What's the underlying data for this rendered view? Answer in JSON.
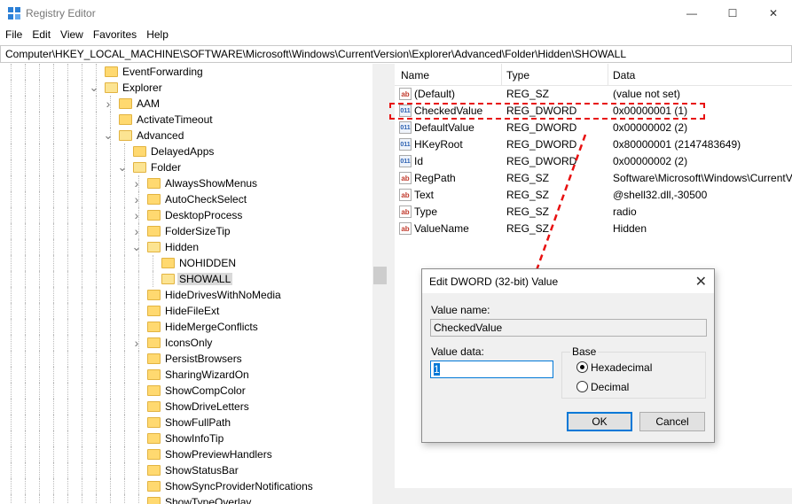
{
  "window": {
    "title": "Registry Editor",
    "minimize": "—",
    "maximize": "☐",
    "close": "✕"
  },
  "menu": [
    "File",
    "Edit",
    "View",
    "Favorites",
    "Help"
  ],
  "address": "Computer\\HKEY_LOCAL_MACHINE\\SOFTWARE\\Microsoft\\Windows\\CurrentVersion\\Explorer\\Advanced\\Folder\\Hidden\\SHOWALL",
  "tree": [
    {
      "label": "EventForwarding",
      "depth": 0,
      "expander": "",
      "selected": false
    },
    {
      "label": "Explorer",
      "depth": 0,
      "expander": "v",
      "selected": false
    },
    {
      "label": "AAM",
      "depth": 1,
      "expander": ">",
      "selected": false
    },
    {
      "label": "ActivateTimeout",
      "depth": 1,
      "expander": "",
      "selected": false
    },
    {
      "label": "Advanced",
      "depth": 1,
      "expander": "v",
      "selected": false
    },
    {
      "label": "DelayedApps",
      "depth": 2,
      "expander": "",
      "selected": false
    },
    {
      "label": "Folder",
      "depth": 2,
      "expander": "v",
      "selected": false
    },
    {
      "label": "AlwaysShowMenus",
      "depth": 3,
      "expander": ">",
      "selected": false
    },
    {
      "label": "AutoCheckSelect",
      "depth": 3,
      "expander": ">",
      "selected": false
    },
    {
      "label": "DesktopProcess",
      "depth": 3,
      "expander": ">",
      "selected": false
    },
    {
      "label": "FolderSizeTip",
      "depth": 3,
      "expander": ">",
      "selected": false
    },
    {
      "label": "Hidden",
      "depth": 3,
      "expander": "v",
      "selected": false
    },
    {
      "label": "NOHIDDEN",
      "depth": 4,
      "expander": "",
      "selected": false
    },
    {
      "label": "SHOWALL",
      "depth": 4,
      "expander": "",
      "selected": true
    },
    {
      "label": "HideDrivesWithNoMedia",
      "depth": 3,
      "expander": "",
      "selected": false
    },
    {
      "label": "HideFileExt",
      "depth": 3,
      "expander": "",
      "selected": false
    },
    {
      "label": "HideMergeConflicts",
      "depth": 3,
      "expander": "",
      "selected": false
    },
    {
      "label": "IconsOnly",
      "depth": 3,
      "expander": ">",
      "selected": false
    },
    {
      "label": "PersistBrowsers",
      "depth": 3,
      "expander": "",
      "selected": false
    },
    {
      "label": "SharingWizardOn",
      "depth": 3,
      "expander": "",
      "selected": false
    },
    {
      "label": "ShowCompColor",
      "depth": 3,
      "expander": "",
      "selected": false
    },
    {
      "label": "ShowDriveLetters",
      "depth": 3,
      "expander": "",
      "selected": false
    },
    {
      "label": "ShowFullPath",
      "depth": 3,
      "expander": "",
      "selected": false
    },
    {
      "label": "ShowInfoTip",
      "depth": 3,
      "expander": "",
      "selected": false
    },
    {
      "label": "ShowPreviewHandlers",
      "depth": 3,
      "expander": "",
      "selected": false
    },
    {
      "label": "ShowStatusBar",
      "depth": 3,
      "expander": "",
      "selected": false
    },
    {
      "label": "ShowSyncProviderNotifications",
      "depth": 3,
      "expander": "",
      "selected": false
    },
    {
      "label": "ShowTypeOverlay",
      "depth": 3,
      "expander": "",
      "selected": false
    }
  ],
  "list": {
    "columns": [
      "Name",
      "Type",
      "Data"
    ],
    "rows": [
      {
        "icon": "ab",
        "name": "(Default)",
        "type": "REG_SZ",
        "data": "(value not set)"
      },
      {
        "icon": "bin",
        "name": "CheckedValue",
        "type": "REG_DWORD",
        "data": "0x00000001 (1)"
      },
      {
        "icon": "bin",
        "name": "DefaultValue",
        "type": "REG_DWORD",
        "data": "0x00000002 (2)"
      },
      {
        "icon": "bin",
        "name": "HKeyRoot",
        "type": "REG_DWORD",
        "data": "0x80000001 (2147483649)"
      },
      {
        "icon": "bin",
        "name": "Id",
        "type": "REG_DWORD",
        "data": "0x00000002 (2)"
      },
      {
        "icon": "ab",
        "name": "RegPath",
        "type": "REG_SZ",
        "data": "Software\\Microsoft\\Windows\\CurrentV"
      },
      {
        "icon": "ab",
        "name": "Text",
        "type": "REG_SZ",
        "data": "@shell32.dll,-30500"
      },
      {
        "icon": "ab",
        "name": "Type",
        "type": "REG_SZ",
        "data": "radio"
      },
      {
        "icon": "ab",
        "name": "ValueName",
        "type": "REG_SZ",
        "data": "Hidden"
      }
    ]
  },
  "dialog": {
    "title": "Edit DWORD (32-bit) Value",
    "close": "✕",
    "value_name_label": "Value name:",
    "value_name": "CheckedValue",
    "value_data_label": "Value data:",
    "value_data": "1",
    "base_label": "Base",
    "hex_label": "Hexadecimal",
    "dec_label": "Decimal",
    "ok": "OK",
    "cancel": "Cancel"
  },
  "colors": {
    "annotation": "#e81010",
    "accent": "#0078d7",
    "folder": "#ffd970"
  }
}
